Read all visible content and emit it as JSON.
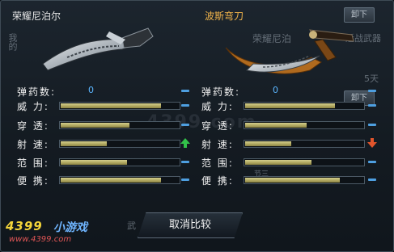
{
  "left_weapon": {
    "name": "荣耀尼泊尔",
    "stats": [
      {
        "label": "弹药数:",
        "value": "0"
      },
      {
        "label": "威  力:",
        "fill": 0.85
      },
      {
        "label": "穿  透:",
        "fill": 0.58
      },
      {
        "label": "射  速:",
        "fill": 0.39
      },
      {
        "label": "范  围:",
        "fill": 0.56
      },
      {
        "label": "便  携:",
        "fill": 0.85
      }
    ]
  },
  "right_weapon": {
    "name": "波斯弯刀",
    "stats": [
      {
        "label": "弹药数:",
        "value": "0"
      },
      {
        "label": "威  力:",
        "fill": 0.76
      },
      {
        "label": "穿  透:",
        "fill": 0.52
      },
      {
        "label": "射  速:",
        "fill": 0.39
      },
      {
        "label": "范  围:",
        "fill": 0.56
      },
      {
        "label": "便  携:",
        "fill": 0.8
      }
    ]
  },
  "comparison_indicators": {
    "left": [
      "equal",
      "equal",
      "equal",
      "higher",
      "equal",
      "equal"
    ],
    "right": [
      "equal",
      "equal",
      "equal",
      "lower",
      "equal",
      "equal"
    ],
    "colors": {
      "equal": "#4e9fe0",
      "higher": "#33c24a",
      "lower": "#e2552c"
    }
  },
  "background_ghost": {
    "button_1": "卸下",
    "button_2": "卸下",
    "item_name": "荣耀尼泊",
    "category": "近战武器",
    "duration": "5天",
    "small_label": "节三",
    "side_label": "我的",
    "tab_label": "武"
  },
  "watermark": "4399.com",
  "cancel_button": {
    "label": "取消比较"
  },
  "branding": {
    "logo": "4399",
    "subtitle": "小游戏",
    "url": "www.4399.com"
  }
}
